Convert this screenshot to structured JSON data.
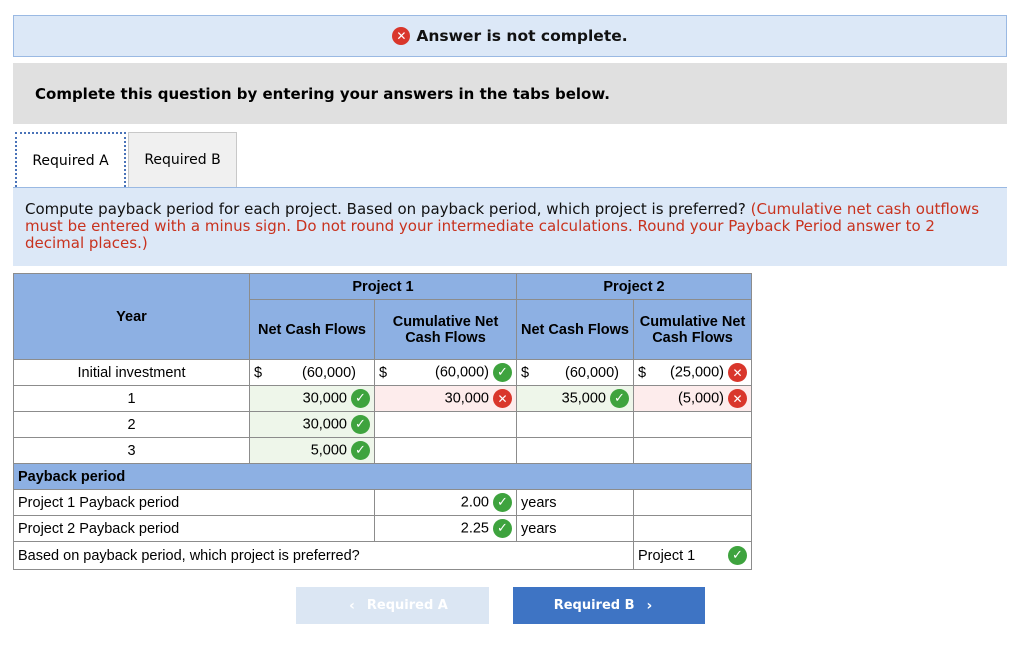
{
  "banner": {
    "icon": "x-circle-icon",
    "text": "Answer is not complete."
  },
  "instructions": "Complete this question by entering your answers in the tabs below.",
  "tabs": [
    {
      "label": "Required A"
    },
    {
      "label": "Required B"
    }
  ],
  "question": {
    "text": "Compute payback period for each project. Based on payback period, which project is preferred?",
    "note": "(Cumulative net cash outflows must be entered with a minus sign. Do not round your intermediate calculations. Round your Payback Period answer to 2 decimal places.)"
  },
  "table": {
    "headers": {
      "year": "Year",
      "project1": "Project 1",
      "project2": "Project 2",
      "net_cash_flows": "Net Cash Flows",
      "cumulative": "Cumulative Net Cash Flows"
    },
    "rows": [
      {
        "year": "Initial investment",
        "p1_net": "(60,000)",
        "p1_cum": "(60,000)",
        "p2_net": "(60,000)",
        "p2_cum": "(25,000)"
      },
      {
        "year": "1",
        "p1_net": "30,000",
        "p1_cum": "30,000",
        "p2_net": "35,000",
        "p2_cum": "(5,000)"
      },
      {
        "year": "2",
        "p1_net": "30,000",
        "p1_cum": "",
        "p2_net": "",
        "p2_cum": ""
      },
      {
        "year": "3",
        "p1_net": "5,000",
        "p1_cum": "",
        "p2_net": "",
        "p2_cum": ""
      }
    ],
    "currency": "$",
    "payback": {
      "section_label": "Payback period",
      "p1_label": "Project 1 Payback period",
      "p1_value": "2.00",
      "p2_label": "Project 2 Payback period",
      "p2_value": "2.25",
      "unit": "years",
      "preferred_question": "Based on payback period, which project is preferred?",
      "preferred_value": "Project 1"
    }
  },
  "nav": {
    "prev_label": "Required A",
    "next_label": "Required B"
  },
  "colors": {
    "correct": "#3ea33e",
    "incorrect": "#d9362b",
    "header": "#8db0e3",
    "accent": "#3e74c4"
  }
}
